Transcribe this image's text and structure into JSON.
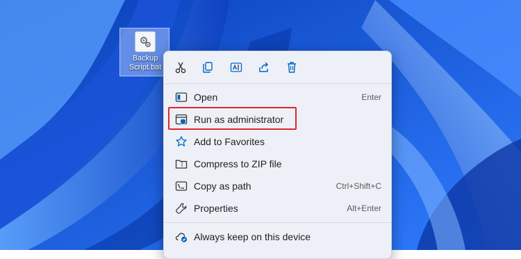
{
  "desktop": {
    "icon_label_line1": "Backup",
    "icon_label_line2": "Script.bat"
  },
  "context_menu": {
    "quick_actions": [
      {
        "name": "cut-icon"
      },
      {
        "name": "copy-icon"
      },
      {
        "name": "rename-icon"
      },
      {
        "name": "share-icon"
      },
      {
        "name": "delete-icon"
      }
    ],
    "items": [
      {
        "label": "Open",
        "shortcut": "Enter",
        "icon": "open-icon"
      },
      {
        "label": "Run as administrator",
        "shortcut": "",
        "icon": "shield-icon",
        "highlighted": true
      },
      {
        "label": "Add to Favorites",
        "shortcut": "",
        "icon": "star-icon"
      },
      {
        "label": "Compress to ZIP file",
        "shortcut": "",
        "icon": "zip-icon"
      },
      {
        "label": "Copy as path",
        "shortcut": "Ctrl+Shift+C",
        "icon": "copy-path-icon"
      },
      {
        "label": "Properties",
        "shortcut": "Alt+Enter",
        "icon": "wrench-icon"
      },
      {
        "label": "Always keep on this device",
        "shortcut": "",
        "icon": "cloud-icon"
      }
    ]
  },
  "colors": {
    "accent": "#0067c0",
    "highlight_border": "#e0262a",
    "wallpaper": "#1f5fe0"
  }
}
